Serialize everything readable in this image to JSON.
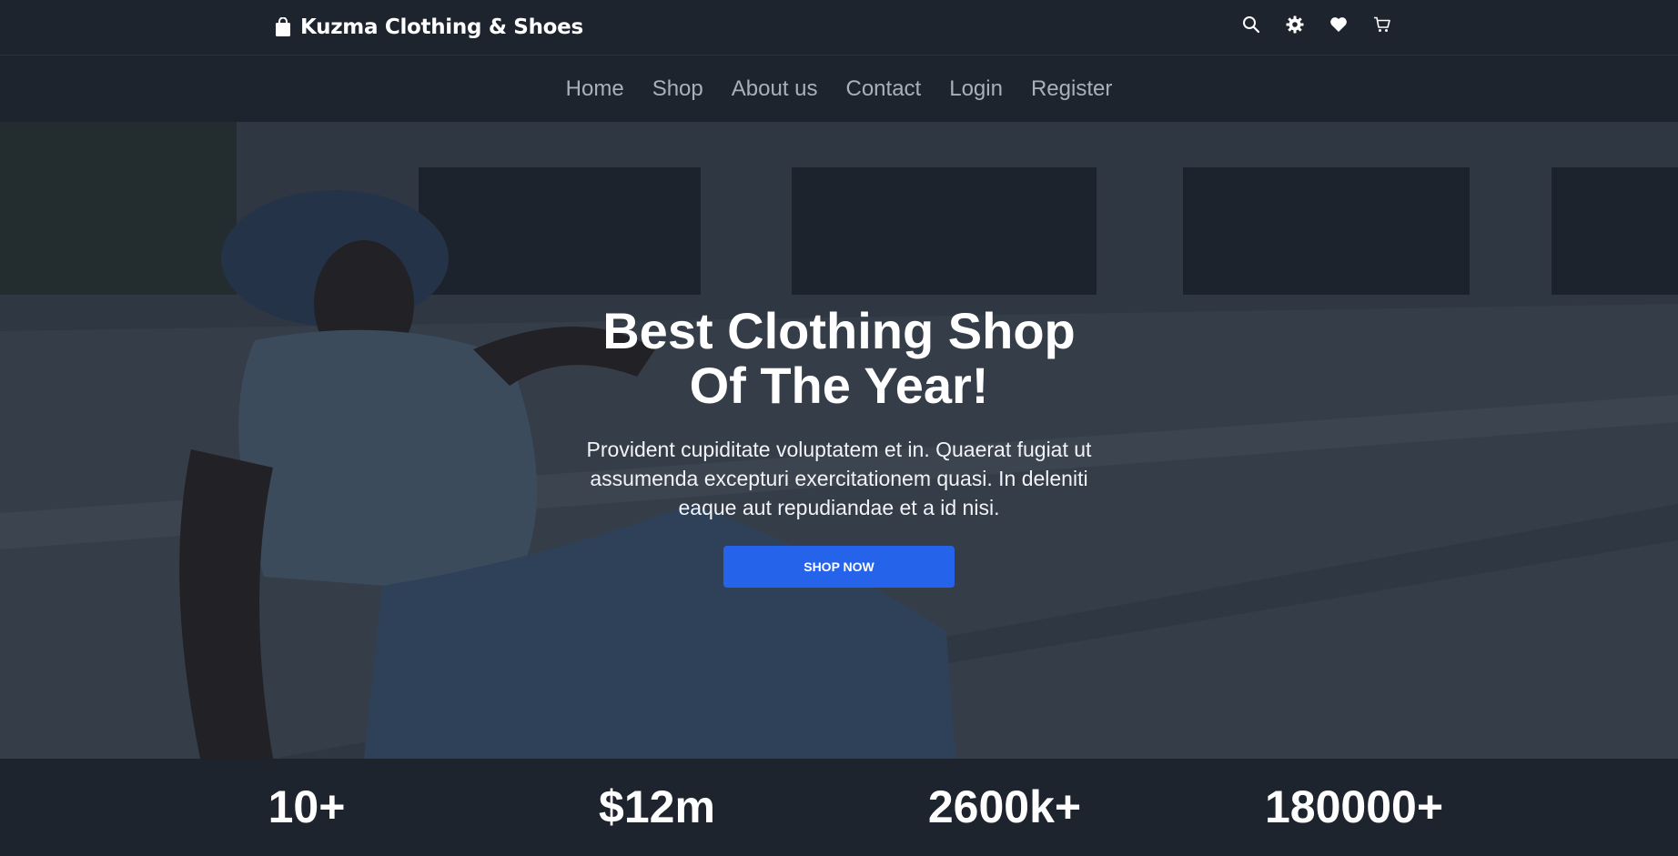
{
  "brand": {
    "name": "Kuzma Clothing & Shoes",
    "icon": "shopping-bag-icon"
  },
  "header_icons": [
    "search-icon",
    "settings-gear-icon",
    "heart-icon",
    "cart-icon"
  ],
  "nav": {
    "items": [
      {
        "label": "Home"
      },
      {
        "label": "Shop"
      },
      {
        "label": "About us"
      },
      {
        "label": "Contact"
      },
      {
        "label": "Login"
      },
      {
        "label": "Register"
      }
    ]
  },
  "hero": {
    "title_line1": "Best Clothing Shop",
    "title_line2": "Of The Year!",
    "text": "Provident cupiditate voluptatem et in. Quaerat fugiat ut assumenda excepturi exercitationem quasi. In deleniti eaque aut repudiandae et a id nisi.",
    "button_label": "SHOP NOW"
  },
  "stats": [
    {
      "value": "10+"
    },
    {
      "value": "$12m"
    },
    {
      "value": "2600k+"
    },
    {
      "value": "180000+"
    }
  ],
  "colors": {
    "background": "#1e242e",
    "accent": "#2563eb",
    "nav_text": "#a9b0bc"
  }
}
